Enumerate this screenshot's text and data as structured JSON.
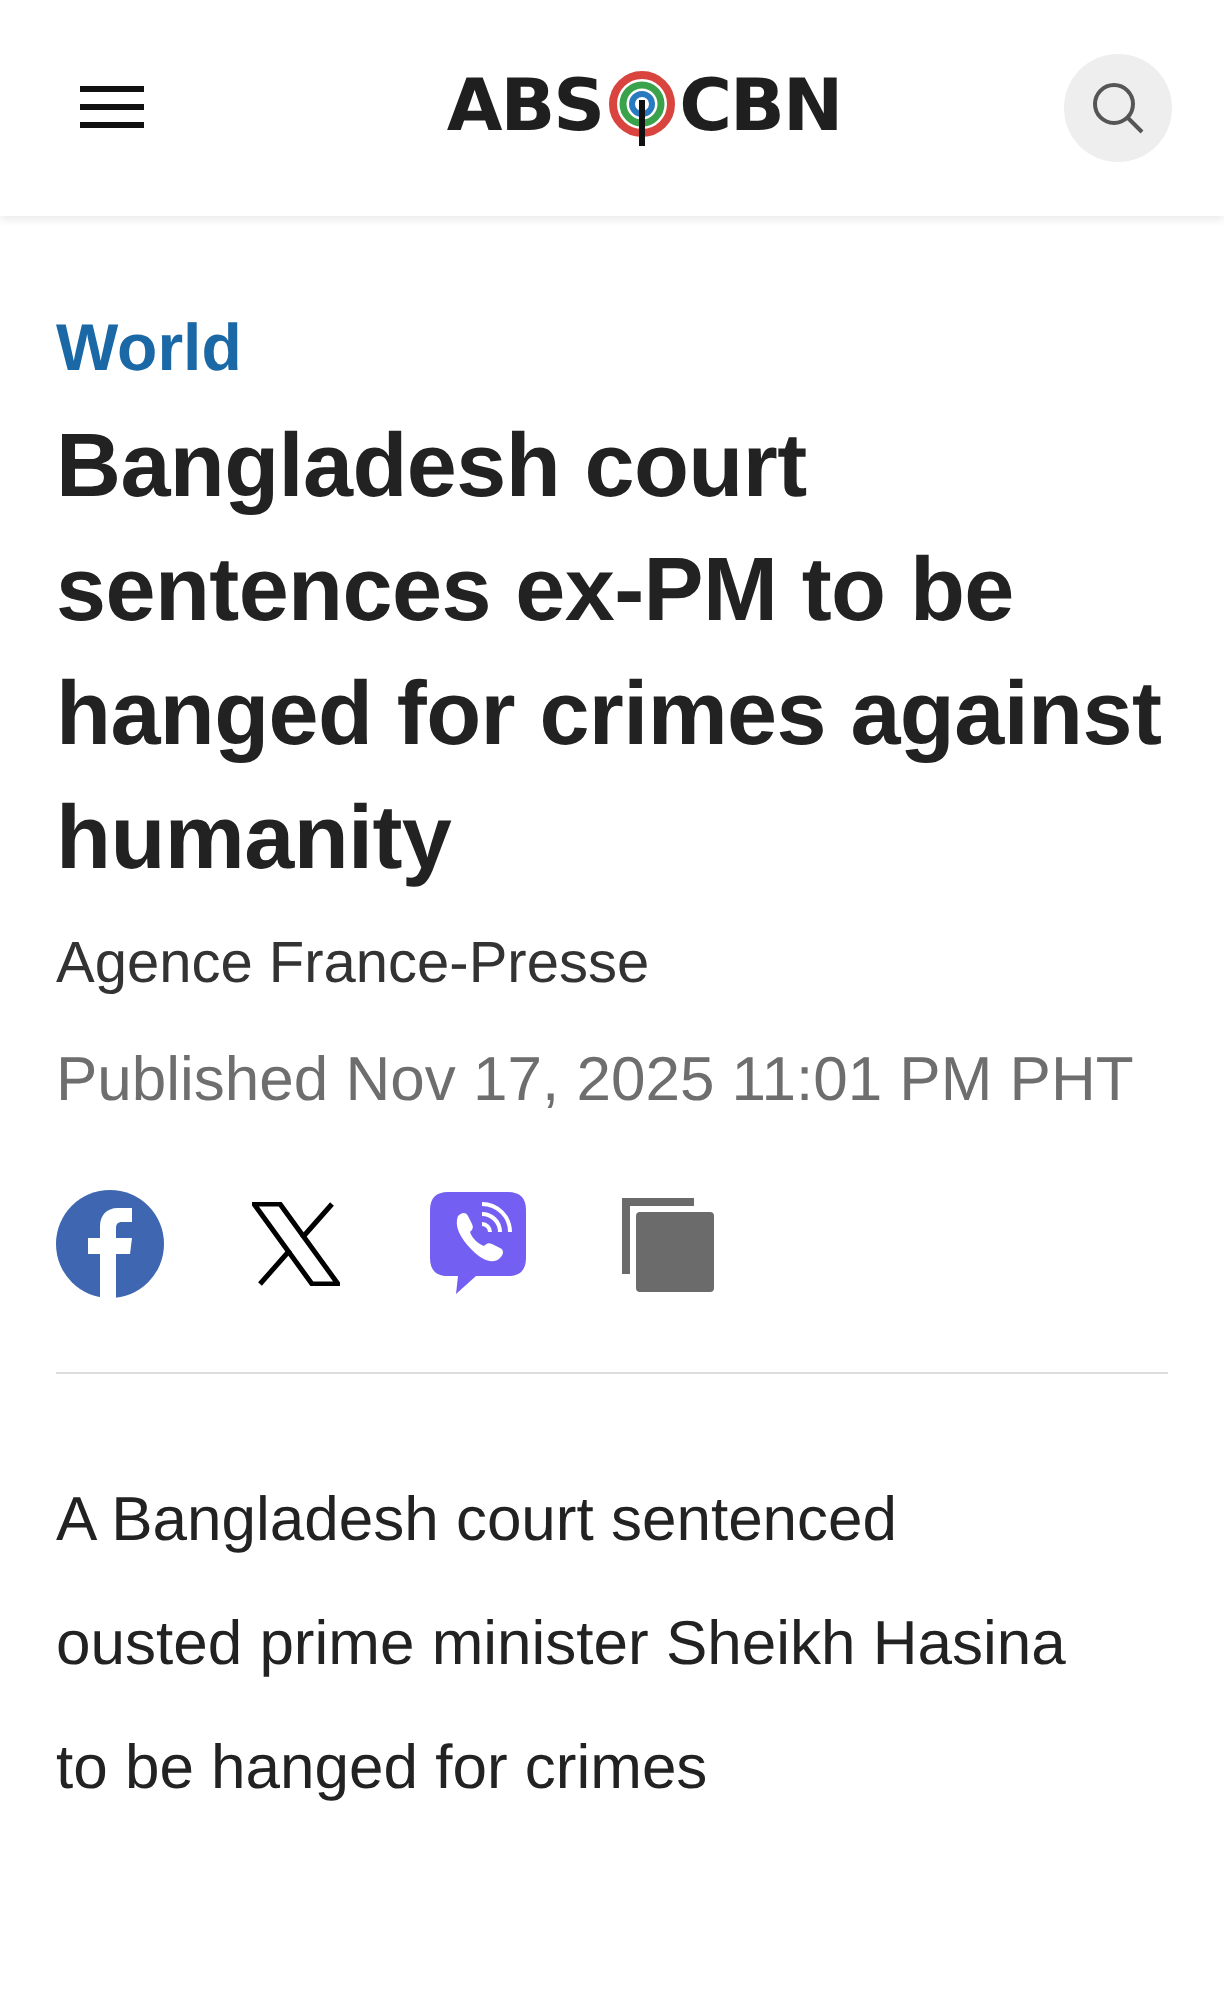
{
  "header": {
    "logo_left": "ABS",
    "logo_right": "CBN"
  },
  "article": {
    "category": "World",
    "headline": "Bangladesh court sentences ex-PM to be hanged for crimes against humanity",
    "author": "Agence France-Presse",
    "published": "Published Nov 17, 2025 11:01 PM PHT",
    "share": [
      {
        "kind": "facebook"
      },
      {
        "kind": "x"
      },
      {
        "kind": "viber"
      },
      {
        "kind": "copy"
      }
    ],
    "body": "A Bangladesh court sentenced ousted prime minister Sheikh Hasina to be hanged for crimes"
  }
}
